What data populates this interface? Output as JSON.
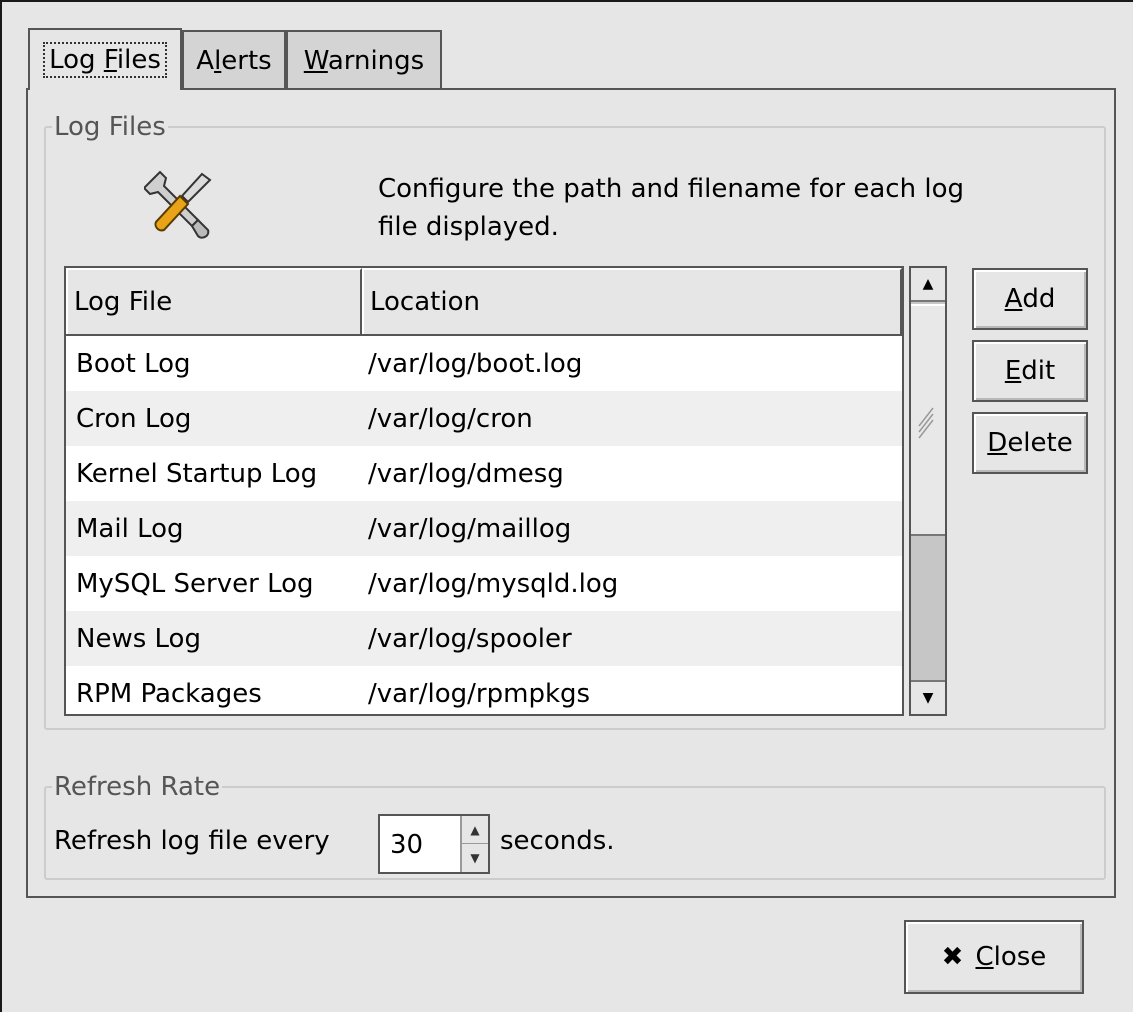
{
  "tabs": [
    {
      "pre": "Log ",
      "u": "F",
      "post": "iles"
    },
    {
      "pre": "A",
      "u": "l",
      "post": "erts"
    },
    {
      "pre": "",
      "u": "W",
      "post": "arnings"
    }
  ],
  "log_files_frame": {
    "legend": "Log Files",
    "description": "Configure the path and filename for each log file displayed.",
    "icon": "tools-icon"
  },
  "table": {
    "columns": [
      "Log File",
      "Location"
    ],
    "rows": [
      {
        "name": "Boot Log",
        "location": "/var/log/boot.log"
      },
      {
        "name": "Cron Log",
        "location": "/var/log/cron"
      },
      {
        "name": "Kernel Startup Log",
        "location": "/var/log/dmesg"
      },
      {
        "name": "Mail Log",
        "location": "/var/log/maillog"
      },
      {
        "name": "MySQL Server Log",
        "location": "/var/log/mysqld.log"
      },
      {
        "name": "News Log",
        "location": "/var/log/spooler"
      },
      {
        "name": "RPM Packages",
        "location": "/var/log/rpmpkgs"
      }
    ]
  },
  "buttons": {
    "add": {
      "u": "A",
      "post": "dd"
    },
    "edit": {
      "u": "E",
      "post": "dit"
    },
    "delete": {
      "u": "D",
      "post": "elete"
    },
    "close": {
      "icon": "✖",
      "u": "C",
      "post": "lose"
    }
  },
  "refresh_frame": {
    "legend": "Refresh Rate",
    "label": "Refresh log file every",
    "value": "30",
    "unit": "seconds."
  }
}
